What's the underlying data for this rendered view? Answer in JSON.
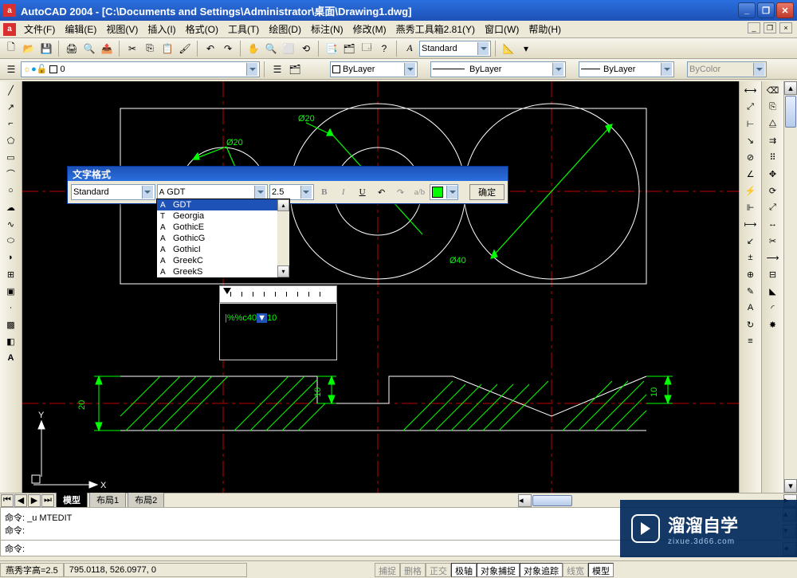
{
  "title": "AutoCAD 2004 - [C:\\Documents and Settings\\Administrator\\桌面\\Drawing1.dwg]",
  "menu": {
    "items": [
      "文件(F)",
      "编辑(E)",
      "视图(V)",
      "插入(I)",
      "格式(O)",
      "工具(T)",
      "绘图(D)",
      "标注(N)",
      "修改(M)",
      "燕秀工具箱2.81(Y)",
      "窗口(W)",
      "帮助(H)"
    ]
  },
  "layer_combo": "0",
  "style_combo": "Standard",
  "color_combo1": "ByLayer",
  "linetype_combo": "ByLayer",
  "lineweight_combo": "ByLayer",
  "color_combo2": "ByColor",
  "tabs": {
    "items": [
      "模型",
      "布局1",
      "布局2"
    ],
    "active": 0
  },
  "cmd": {
    "lines": [
      "命令: _u MTEDIT",
      "命令:",
      "命令:"
    ]
  },
  "status": {
    "left1": "燕秀字高=2.5",
    "coords": "795.0118, 526.0977, 0",
    "toggles": [
      "捕捉",
      "删格",
      "正交",
      "极轴",
      "对象捕捉",
      "对象追踪",
      "线宽",
      "模型"
    ],
    "active_toggles": [
      3,
      4,
      5,
      7
    ]
  },
  "txtfmt": {
    "title": "文字格式",
    "style": "Standard",
    "font": "GDT",
    "size": "2.5",
    "ok": "确定",
    "bold": "B",
    "italic": "I",
    "underline": "U"
  },
  "fontlist": {
    "items": [
      "GDT",
      "Georgia",
      "GothicE",
      "GothicG",
      "GothicI",
      "GreekC",
      "GreekS"
    ],
    "selected": 0
  },
  "mtext": {
    "pre": "|%%c40",
    "sel": "▼",
    "post": "10"
  },
  "dims": {
    "d20a": "Ø20",
    "d20b": "Ø20",
    "d40": "Ø40",
    "v20": "20",
    "v10a": "10",
    "v10b": "10"
  },
  "ucs": {
    "x": "X",
    "y": "Y"
  },
  "watermark": {
    "t1": "溜溜自学",
    "t2": "zixue.3d66.com"
  }
}
